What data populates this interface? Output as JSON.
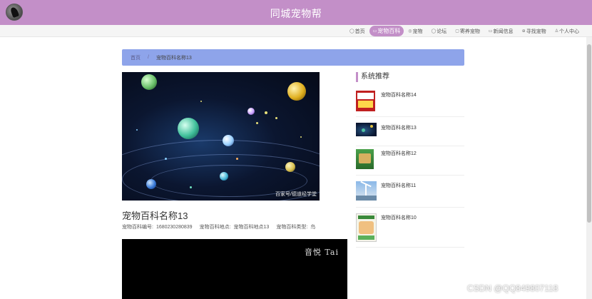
{
  "header": {
    "title": "同城宠物帮"
  },
  "nav": {
    "items": [
      {
        "icon": "home-icon",
        "glyph": "◯",
        "label": "首页"
      },
      {
        "icon": "book-icon",
        "glyph": "▭",
        "label": "宠物百科",
        "active": true
      },
      {
        "icon": "paw-icon",
        "glyph": "◎",
        "label": "宠物"
      },
      {
        "icon": "forum-icon",
        "glyph": "◯",
        "label": "论坛"
      },
      {
        "icon": "adopt-icon",
        "glyph": "▢",
        "label": "寄养宠物"
      },
      {
        "icon": "news-icon",
        "glyph": "▭",
        "label": "新闻信息"
      },
      {
        "icon": "search-icon",
        "glyph": "⊕",
        "label": "寻找宠物"
      },
      {
        "icon": "user-icon",
        "glyph": "♙",
        "label": "个人中心"
      }
    ]
  },
  "breadcrumb": {
    "home": "首页",
    "separator": "/",
    "current": "宠物百科名称13"
  },
  "hero": {
    "caption": "百家号/德道经学堂"
  },
  "detail": {
    "title": "宠物百科名称13",
    "meta": [
      {
        "key": "宠物百科编号:",
        "value": "1680230280839"
      },
      {
        "key": "宠物百科地点:",
        "value": "宠物百科地点13"
      },
      {
        "key": "宠物百科类型:",
        "value": "鸟"
      }
    ]
  },
  "video": {
    "overlay_text": "音悦 Tai"
  },
  "sidebar": {
    "title": "系统推荐",
    "items": [
      {
        "name": "宠物百科名称14",
        "thumb": "encyclopedia-book-cover"
      },
      {
        "name": "宠物百科名称13",
        "thumb": "space-image"
      },
      {
        "name": "宠物百科名称12",
        "thumb": "green-book-cover"
      },
      {
        "name": "宠物百科名称11",
        "thumb": "wind-turbine-image"
      },
      {
        "name": "宠物百科名称10",
        "thumb": "children-book-cover"
      }
    ]
  },
  "watermark": "CSDN @QQ849807118",
  "colors": {
    "accent": "#c38fc8",
    "breadcrumb_bg": "#8ea4ea"
  }
}
